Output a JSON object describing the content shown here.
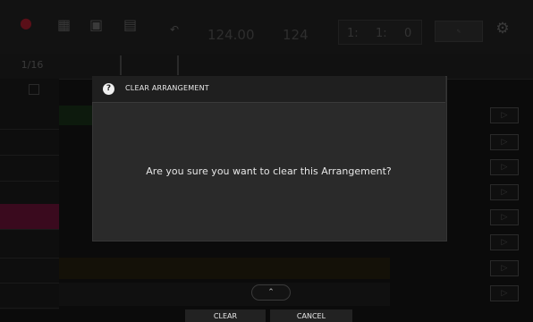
{
  "dialog": {
    "title": "CLEAR ARRANGEMENT",
    "question_icon": "?",
    "message": "Are you sure you want to clear this Arrangement?"
  },
  "footer": {
    "clear_label": "CLEAR",
    "cancel_label": "CANCEL"
  },
  "toolbar": {
    "bpm_value": "124.00",
    "bars_value": "124",
    "position": [
      "1:",
      "1:",
      "0"
    ],
    "quantize": "1/16"
  },
  "icons": {
    "gear": "gear-icon",
    "question": "question-icon",
    "scroll_up": "chevron-up-icon",
    "play": "play-icon"
  },
  "colors": {
    "dialog_bg": "#2a2a2a",
    "header_bg": "#1f1f1f",
    "button_bg": "#222222",
    "text": "#e8e8e8"
  }
}
